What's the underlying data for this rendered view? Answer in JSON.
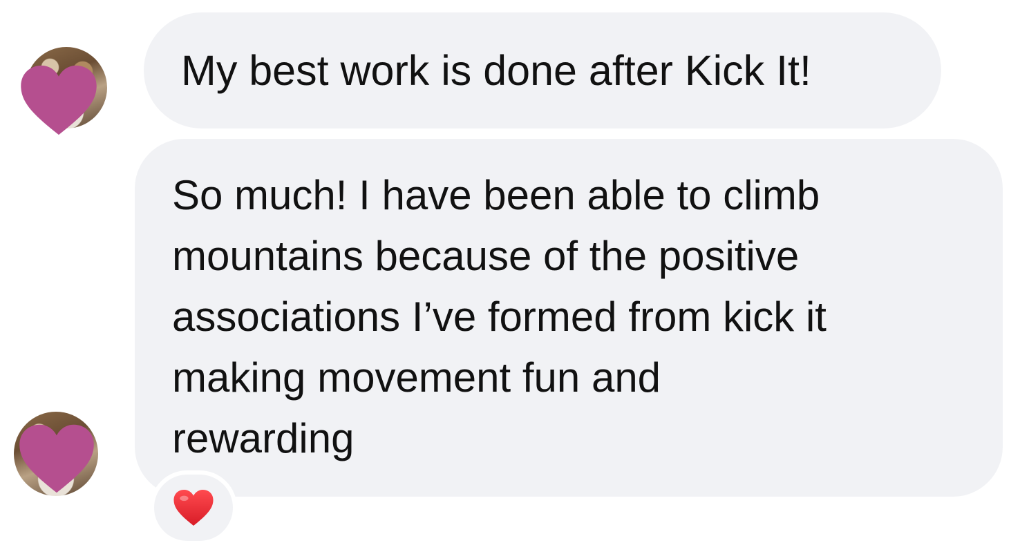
{
  "messages": [
    {
      "avatar_icon": "user-avatar-redacted-heart",
      "text": "My best work is done after Kick It!"
    },
    {
      "avatar_icon": "user-avatar-redacted-heart",
      "lines": [
        "So much! I have been able to climb",
        "mountains because of the positive",
        "associations I’ve formed from kick it",
        "making movement fun and",
        "rewarding"
      ],
      "reaction": "❤️"
    }
  ],
  "colors": {
    "bubble_background": "#f1f2f5",
    "text": "#111111",
    "redaction_heart": "#b54f8f",
    "reaction_heart": "#e0242f"
  }
}
